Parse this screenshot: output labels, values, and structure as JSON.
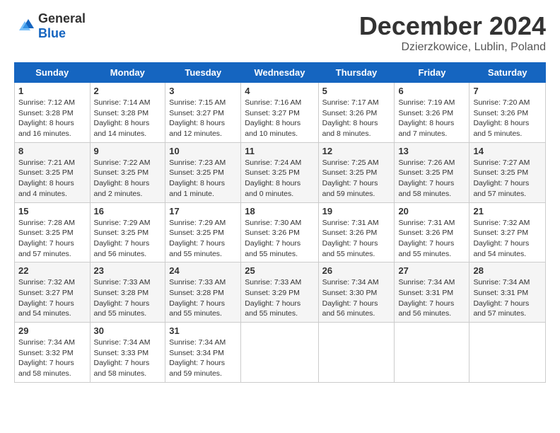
{
  "header": {
    "logo_general": "General",
    "logo_blue": "Blue",
    "month_title": "December 2024",
    "location": "Dzierzkowice, Lublin, Poland"
  },
  "calendar": {
    "days_of_week": [
      "Sunday",
      "Monday",
      "Tuesday",
      "Wednesday",
      "Thursday",
      "Friday",
      "Saturday"
    ],
    "weeks": [
      [
        {
          "day": "1",
          "info": "Sunrise: 7:12 AM\nSunset: 3:28 PM\nDaylight: 8 hours\nand 16 minutes."
        },
        {
          "day": "2",
          "info": "Sunrise: 7:14 AM\nSunset: 3:28 PM\nDaylight: 8 hours\nand 14 minutes."
        },
        {
          "day": "3",
          "info": "Sunrise: 7:15 AM\nSunset: 3:27 PM\nDaylight: 8 hours\nand 12 minutes."
        },
        {
          "day": "4",
          "info": "Sunrise: 7:16 AM\nSunset: 3:27 PM\nDaylight: 8 hours\nand 10 minutes."
        },
        {
          "day": "5",
          "info": "Sunrise: 7:17 AM\nSunset: 3:26 PM\nDaylight: 8 hours\nand 8 minutes."
        },
        {
          "day": "6",
          "info": "Sunrise: 7:19 AM\nSunset: 3:26 PM\nDaylight: 8 hours\nand 7 minutes."
        },
        {
          "day": "7",
          "info": "Sunrise: 7:20 AM\nSunset: 3:26 PM\nDaylight: 8 hours\nand 5 minutes."
        }
      ],
      [
        {
          "day": "8",
          "info": "Sunrise: 7:21 AM\nSunset: 3:25 PM\nDaylight: 8 hours\nand 4 minutes."
        },
        {
          "day": "9",
          "info": "Sunrise: 7:22 AM\nSunset: 3:25 PM\nDaylight: 8 hours\nand 2 minutes."
        },
        {
          "day": "10",
          "info": "Sunrise: 7:23 AM\nSunset: 3:25 PM\nDaylight: 8 hours\nand 1 minute."
        },
        {
          "day": "11",
          "info": "Sunrise: 7:24 AM\nSunset: 3:25 PM\nDaylight: 8 hours\nand 0 minutes."
        },
        {
          "day": "12",
          "info": "Sunrise: 7:25 AM\nSunset: 3:25 PM\nDaylight: 7 hours\nand 59 minutes."
        },
        {
          "day": "13",
          "info": "Sunrise: 7:26 AM\nSunset: 3:25 PM\nDaylight: 7 hours\nand 58 minutes."
        },
        {
          "day": "14",
          "info": "Sunrise: 7:27 AM\nSunset: 3:25 PM\nDaylight: 7 hours\nand 57 minutes."
        }
      ],
      [
        {
          "day": "15",
          "info": "Sunrise: 7:28 AM\nSunset: 3:25 PM\nDaylight: 7 hours\nand 57 minutes."
        },
        {
          "day": "16",
          "info": "Sunrise: 7:29 AM\nSunset: 3:25 PM\nDaylight: 7 hours\nand 56 minutes."
        },
        {
          "day": "17",
          "info": "Sunrise: 7:29 AM\nSunset: 3:25 PM\nDaylight: 7 hours\nand 55 minutes."
        },
        {
          "day": "18",
          "info": "Sunrise: 7:30 AM\nSunset: 3:26 PM\nDaylight: 7 hours\nand 55 minutes."
        },
        {
          "day": "19",
          "info": "Sunrise: 7:31 AM\nSunset: 3:26 PM\nDaylight: 7 hours\nand 55 minutes."
        },
        {
          "day": "20",
          "info": "Sunrise: 7:31 AM\nSunset: 3:26 PM\nDaylight: 7 hours\nand 55 minutes."
        },
        {
          "day": "21",
          "info": "Sunrise: 7:32 AM\nSunset: 3:27 PM\nDaylight: 7 hours\nand 54 minutes."
        }
      ],
      [
        {
          "day": "22",
          "info": "Sunrise: 7:32 AM\nSunset: 3:27 PM\nDaylight: 7 hours\nand 54 minutes."
        },
        {
          "day": "23",
          "info": "Sunrise: 7:33 AM\nSunset: 3:28 PM\nDaylight: 7 hours\nand 55 minutes."
        },
        {
          "day": "24",
          "info": "Sunrise: 7:33 AM\nSunset: 3:28 PM\nDaylight: 7 hours\nand 55 minutes."
        },
        {
          "day": "25",
          "info": "Sunrise: 7:33 AM\nSunset: 3:29 PM\nDaylight: 7 hours\nand 55 minutes."
        },
        {
          "day": "26",
          "info": "Sunrise: 7:34 AM\nSunset: 3:30 PM\nDaylight: 7 hours\nand 56 minutes."
        },
        {
          "day": "27",
          "info": "Sunrise: 7:34 AM\nSunset: 3:31 PM\nDaylight: 7 hours\nand 56 minutes."
        },
        {
          "day": "28",
          "info": "Sunrise: 7:34 AM\nSunset: 3:31 PM\nDaylight: 7 hours\nand 57 minutes."
        }
      ],
      [
        {
          "day": "29",
          "info": "Sunrise: 7:34 AM\nSunset: 3:32 PM\nDaylight: 7 hours\nand 58 minutes."
        },
        {
          "day": "30",
          "info": "Sunrise: 7:34 AM\nSunset: 3:33 PM\nDaylight: 7 hours\nand 58 minutes."
        },
        {
          "day": "31",
          "info": "Sunrise: 7:34 AM\nSunset: 3:34 PM\nDaylight: 7 hours\nand 59 minutes."
        },
        {
          "day": "",
          "info": ""
        },
        {
          "day": "",
          "info": ""
        },
        {
          "day": "",
          "info": ""
        },
        {
          "day": "",
          "info": ""
        }
      ]
    ]
  }
}
